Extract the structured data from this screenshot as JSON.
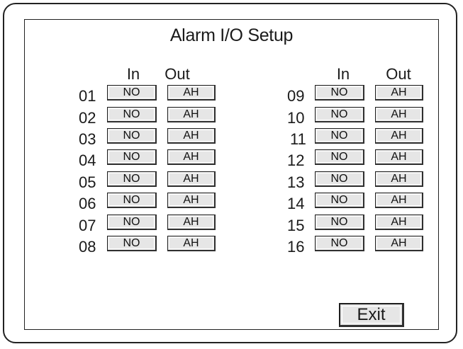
{
  "title": "Alarm I/O Setup",
  "columns": {
    "in_label": "In",
    "out_label": "Out"
  },
  "channels_left": [
    {
      "number": "01",
      "in": "NO",
      "out": "AH"
    },
    {
      "number": "02",
      "in": "NO",
      "out": "AH"
    },
    {
      "number": "03",
      "in": "NO",
      "out": "AH"
    },
    {
      "number": "04",
      "in": "NO",
      "out": "AH"
    },
    {
      "number": "05",
      "in": "NO",
      "out": "AH"
    },
    {
      "number": "06",
      "in": "NO",
      "out": "AH"
    },
    {
      "number": "07",
      "in": "NO",
      "out": "AH"
    },
    {
      "number": "08",
      "in": "NO",
      "out": "AH"
    }
  ],
  "channels_right": [
    {
      "number": "09",
      "in": "NO",
      "out": "AH"
    },
    {
      "number": "10",
      "in": "NO",
      "out": "AH"
    },
    {
      "number": "11",
      "in": "NO",
      "out": "AH"
    },
    {
      "number": "12",
      "in": "NO",
      "out": "AH"
    },
    {
      "number": "13",
      "in": "NO",
      "out": "AH"
    },
    {
      "number": "14",
      "in": "NO",
      "out": "AH"
    },
    {
      "number": "15",
      "in": "NO",
      "out": "AH"
    },
    {
      "number": "16",
      "in": "NO",
      "out": "AH"
    }
  ],
  "exit_label": "Exit"
}
